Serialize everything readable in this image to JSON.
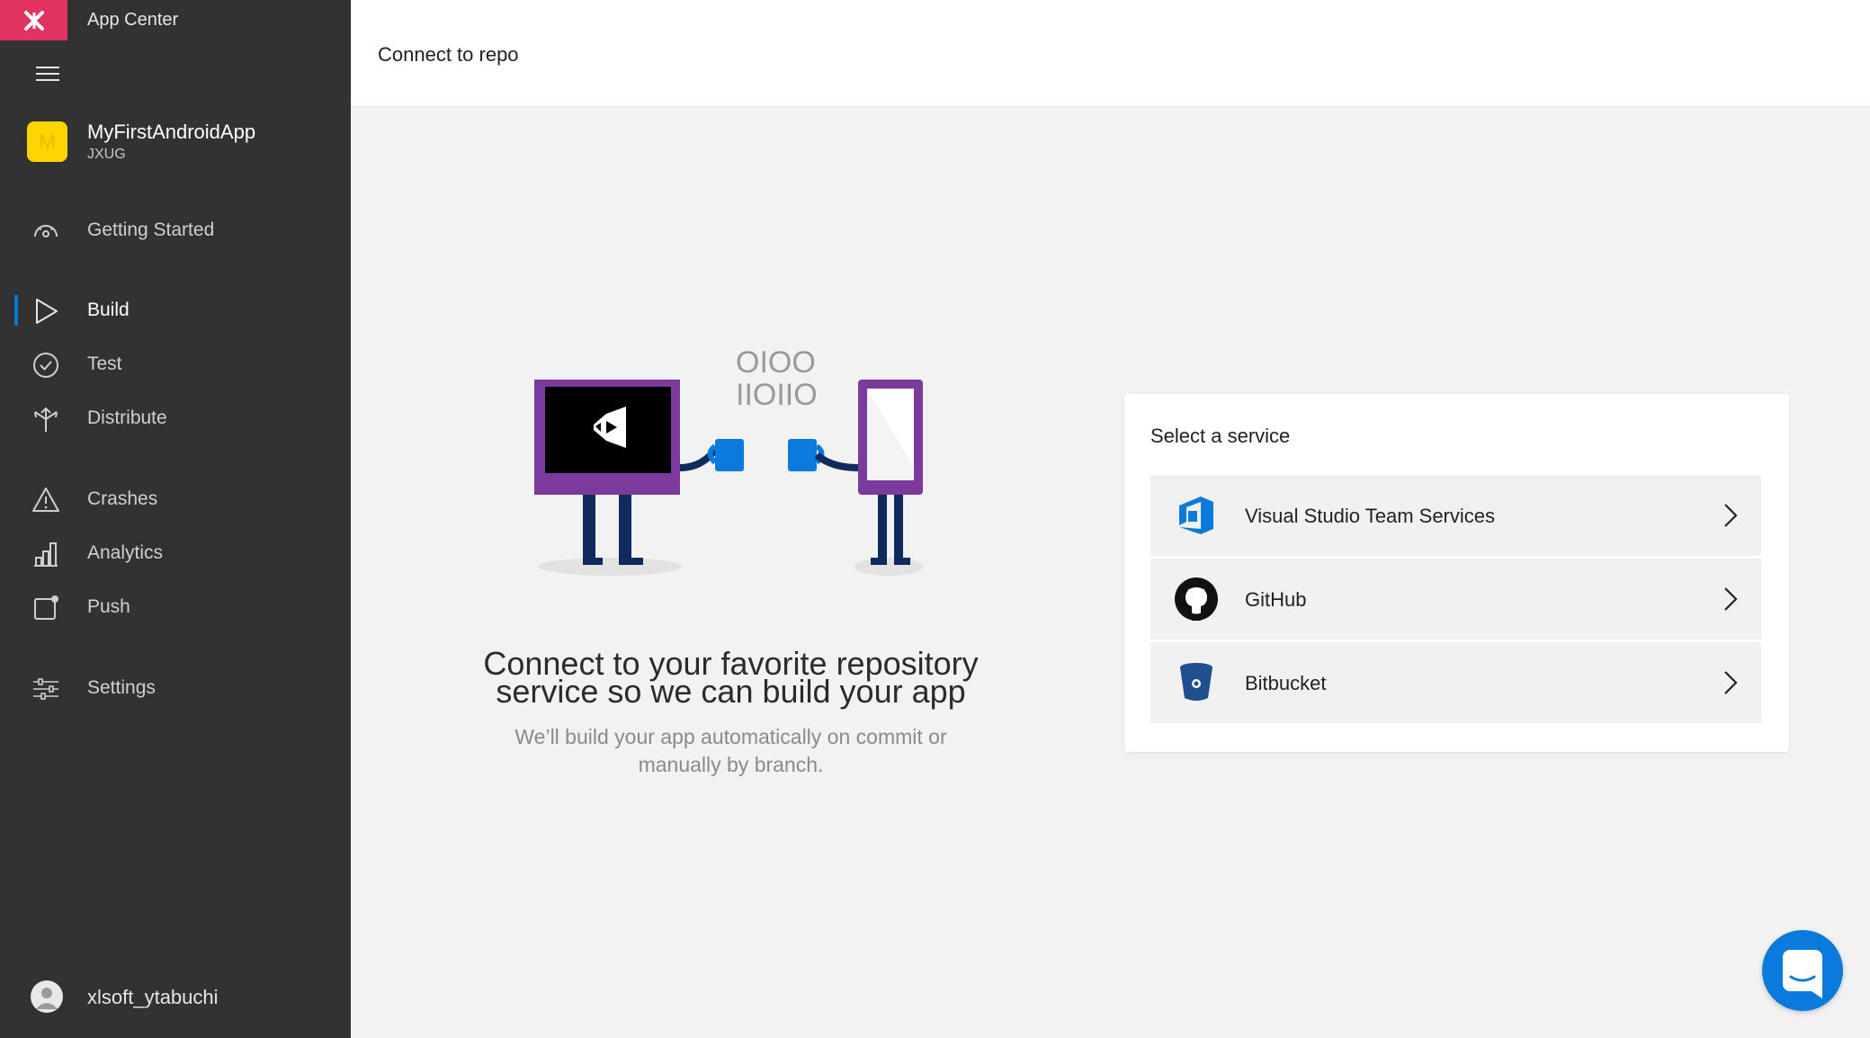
{
  "app": {
    "brand_name": "App Center"
  },
  "sidebar": {
    "app_initial": "M",
    "app_name": "MyFirstAndroidApp",
    "app_org": "JXUG",
    "items": [
      {
        "label": "Getting Started",
        "icon": "gauge-icon"
      },
      {
        "label": "Build",
        "icon": "play-icon",
        "active": true
      },
      {
        "label": "Test",
        "icon": "check-circle-icon"
      },
      {
        "label": "Distribute",
        "icon": "distribute-icon"
      },
      {
        "label": "Crashes",
        "icon": "warning-icon"
      },
      {
        "label": "Analytics",
        "icon": "bar-chart-icon"
      },
      {
        "label": "Push",
        "icon": "push-icon"
      },
      {
        "label": "Settings",
        "icon": "sliders-icon"
      }
    ],
    "user_name": "xlsoft_ytabuchi"
  },
  "header": {
    "title": "Connect to repo"
  },
  "main": {
    "binary_line1": "OIOO",
    "binary_line2": "IIOIIO",
    "headline_line1": "Connect to your favorite repository",
    "headline_line2": "service so we can build your app",
    "subtext_line1": "We’ll build your app automatically on commit or",
    "subtext_line2": "manually by branch."
  },
  "services": {
    "title": "Select a service",
    "items": [
      {
        "label": "Visual Studio Team Services",
        "icon": "vsts-icon"
      },
      {
        "label": "GitHub",
        "icon": "github-icon"
      },
      {
        "label": "Bitbucket",
        "icon": "bitbucket-icon"
      }
    ]
  },
  "colors": {
    "sidebar_bg": "#323232",
    "brand_accent": "#e0335f",
    "active_indicator": "#0078d4",
    "chat_button": "#0a7bdc",
    "illustration_purple": "#7b3a9c"
  }
}
